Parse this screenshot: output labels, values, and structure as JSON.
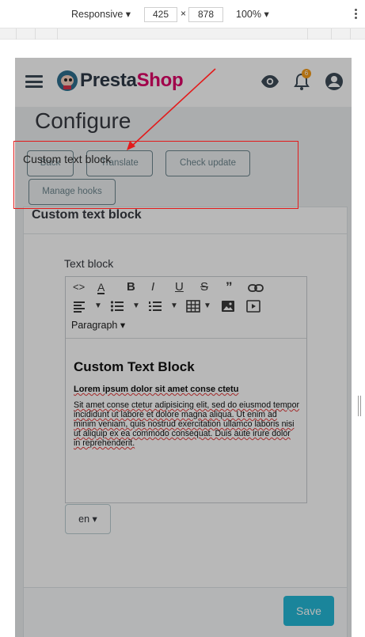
{
  "devtools": {
    "device_mode": "Responsive ▾",
    "width": "425",
    "times": "×",
    "height": "878",
    "zoom": "100% ▾"
  },
  "header": {
    "logo_presta": "Presta",
    "logo_shop": "Shop",
    "notification_count": "6"
  },
  "page": {
    "title": "Configure"
  },
  "toolbar": {
    "back": "Back",
    "translate": "Translate",
    "check_update": "Check update",
    "manage_hooks": "Manage hooks"
  },
  "panel": {
    "heading": "Custom text block",
    "field_label": "Text block"
  },
  "editor": {
    "paragraph": "Paragraph ▾",
    "heading": "Custom Text Block",
    "subheading": "Lorem ipsum dolor sit amet conse ctetu",
    "body": "Sit amet conse ctetur adipisicing elit, sed do eiusmod tempor incididunt ut labore et dolore magna aliqua. Ut enim ad minim veniam, quis nostrud exercitation ullamco laboris nisi ut aliquip ex ea commodo consequat. Duis aute irure dolor in reprehenderit."
  },
  "language": {
    "selected": "en ▾"
  },
  "footer": {
    "save": "Save"
  },
  "annotation": {
    "label": "Custom text block",
    "color": "#e31b1b"
  },
  "colors": {
    "accent": "#25b9d7",
    "brand_pink": "#df0067",
    "badge": "#f59c1a"
  }
}
